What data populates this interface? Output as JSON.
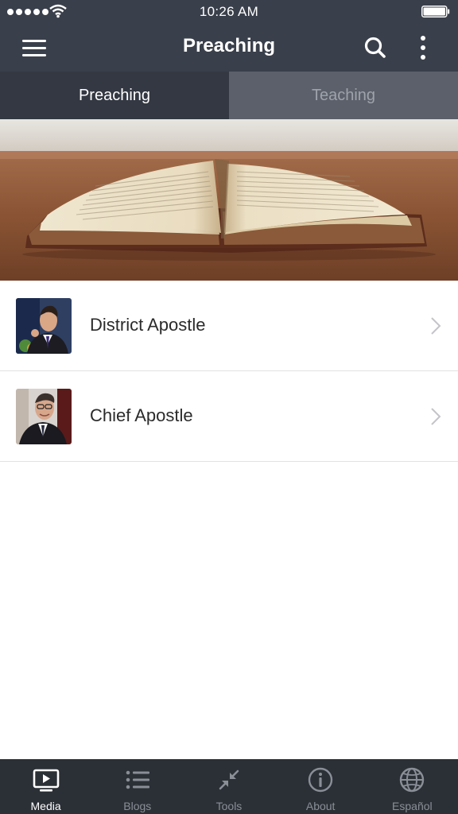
{
  "status_bar": {
    "time": "10:26 AM"
  },
  "header": {
    "title": "Preaching",
    "menu_icon": "hamburger-menu-icon",
    "search_icon": "search-icon",
    "more_icon": "more-vertical-icon"
  },
  "tabs": [
    {
      "label": "Preaching",
      "active": true
    },
    {
      "label": "Teaching",
      "active": false
    }
  ],
  "hero": {
    "icon": "open-book-image"
  },
  "list": {
    "items": [
      {
        "label": "District Apostle",
        "thumb_icon": "district-apostle-photo"
      },
      {
        "label": "Chief Apostle",
        "thumb_icon": "chief-apostle-photo"
      }
    ]
  },
  "tabbar": {
    "items": [
      {
        "label": "Media",
        "icon": "media-play-icon",
        "active": true
      },
      {
        "label": "Blogs",
        "icon": "list-icon",
        "active": false
      },
      {
        "label": "Tools",
        "icon": "tools-compress-icon",
        "active": false
      },
      {
        "label": "About",
        "icon": "info-icon",
        "active": false
      },
      {
        "label": "Español",
        "icon": "globe-icon",
        "active": false
      }
    ]
  },
  "colors": {
    "nav_background": "#3a404b",
    "tab_active": "#333842",
    "tab_inactive": "#5b606a",
    "tabbar_background": "#2b2f36"
  }
}
